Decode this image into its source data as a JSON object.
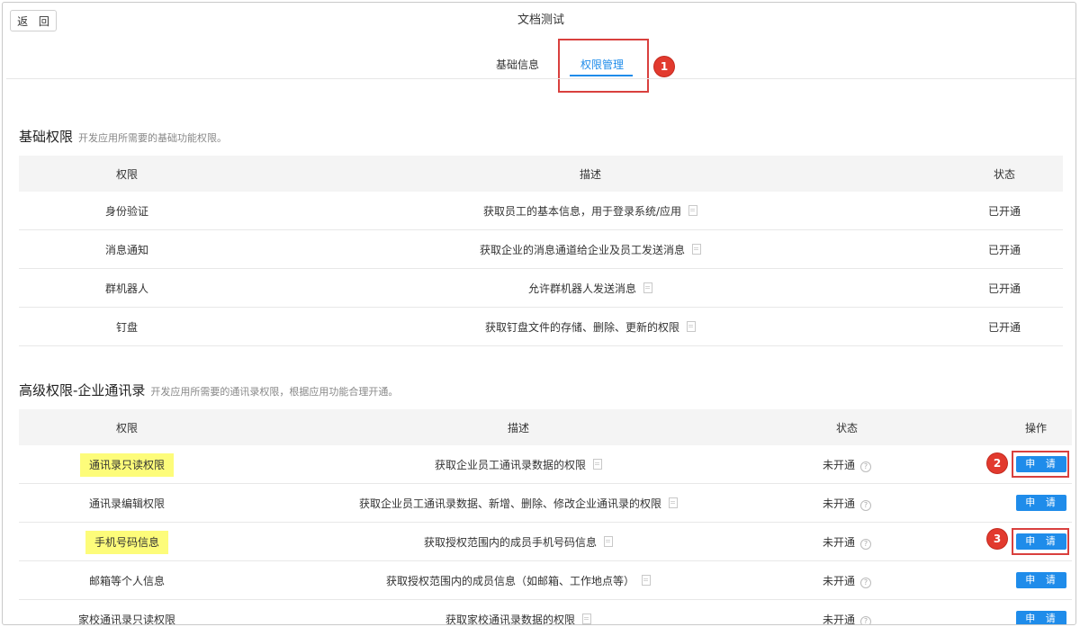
{
  "window": {
    "back_label": "返 回",
    "title": "文档测试"
  },
  "tabs": [
    {
      "label": "基础信息"
    },
    {
      "label": "权限管理"
    }
  ],
  "badges": [
    "1",
    "2",
    "3"
  ],
  "basic_section": {
    "title": "基础权限",
    "subtitle": "开发应用所需要的基础功能权限。",
    "headers": [
      "权限",
      "描述",
      "状态"
    ],
    "rows": [
      {
        "perm": "身份验证",
        "desc": "获取员工的基本信息，用于登录系统/应用",
        "status": "已开通"
      },
      {
        "perm": "消息通知",
        "desc": "获取企业的消息通道给企业及员工发送消息",
        "status": "已开通"
      },
      {
        "perm": "群机器人",
        "desc": "允许群机器人发送消息",
        "status": "已开通"
      },
      {
        "perm": "钉盘",
        "desc": "获取钉盘文件的存储、删除、更新的权限",
        "status": "已开通"
      }
    ]
  },
  "advanced_section": {
    "title": "高级权限-企业通讯录",
    "subtitle": "开发应用所需要的通讯录权限，根据应用功能合理开通。",
    "headers": [
      "权限",
      "描述",
      "状态",
      "操作"
    ],
    "apply_label": "申 请",
    "rows": [
      {
        "perm": "通讯录只读权限",
        "desc": "获取企业员工通讯录数据的权限",
        "status": "未开通"
      },
      {
        "perm": "通讯录编辑权限",
        "desc": "获取企业员工通讯录数据、新增、删除、修改企业通讯录的权限",
        "status": "未开通"
      },
      {
        "perm": "手机号码信息",
        "desc": "获取授权范围内的成员手机号码信息",
        "status": "未开通"
      },
      {
        "perm": "邮箱等个人信息",
        "desc": "获取授权范围内的成员信息（如邮箱、工作地点等）",
        "status": "未开通"
      },
      {
        "perm": "家校通讯录只读权限",
        "desc": "获取家校通讯录数据的权限",
        "status": "未开通"
      }
    ]
  },
  "colors": {
    "accent": "#1f8cea",
    "highlight": "#fdfc7a",
    "annotation": "#d9403e"
  }
}
